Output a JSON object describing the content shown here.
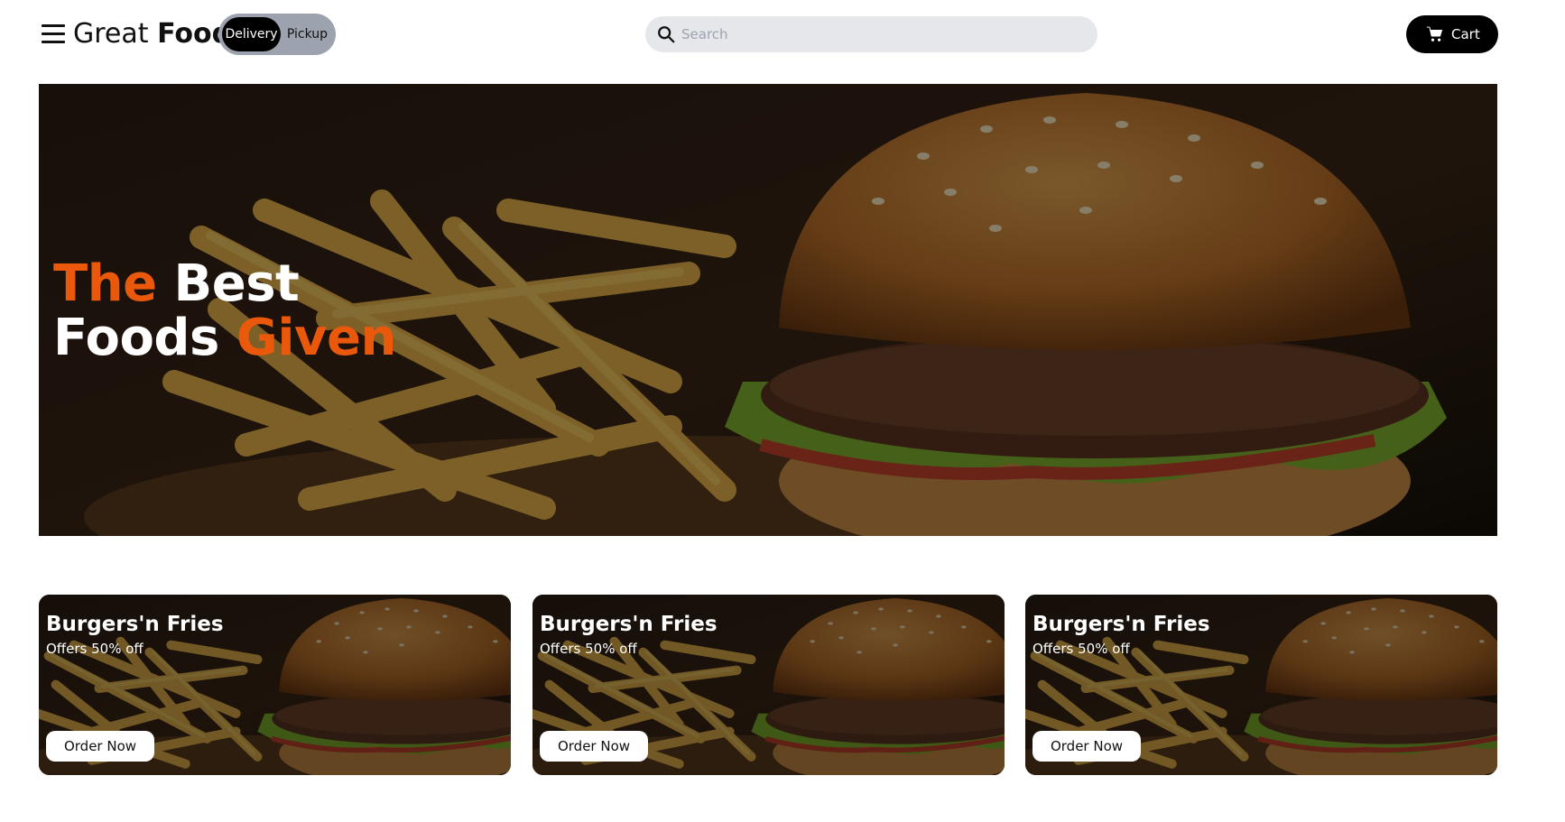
{
  "header": {
    "brand_light": "Great",
    "brand_bold": "Food",
    "toggle": {
      "active": "Delivery",
      "inactive": "Pickup"
    },
    "search": {
      "placeholder": "Search",
      "value": ""
    },
    "cart_label": "Cart"
  },
  "hero": {
    "line1_accent": "The",
    "line1_rest": "Best",
    "line2_start": "Foods",
    "line2_accent": "Given"
  },
  "cards": [
    {
      "title": "Burgers'n Fries",
      "subtitle": "Offers 50% off",
      "button": "Order Now"
    },
    {
      "title": "Burgers'n Fries",
      "subtitle": "Offers 50% off",
      "button": "Order Now"
    },
    {
      "title": "Burgers'n Fries",
      "subtitle": "Offers 50% off",
      "button": "Order Now"
    }
  ],
  "colors": {
    "accent": "#ea580c",
    "toggle_bg": "#9ca3af",
    "search_bg": "#e5e7eb",
    "dark": "#000000"
  },
  "icons": {
    "menu": "hamburger-menu-icon",
    "search": "search-icon",
    "cart": "shopping-cart-icon"
  }
}
